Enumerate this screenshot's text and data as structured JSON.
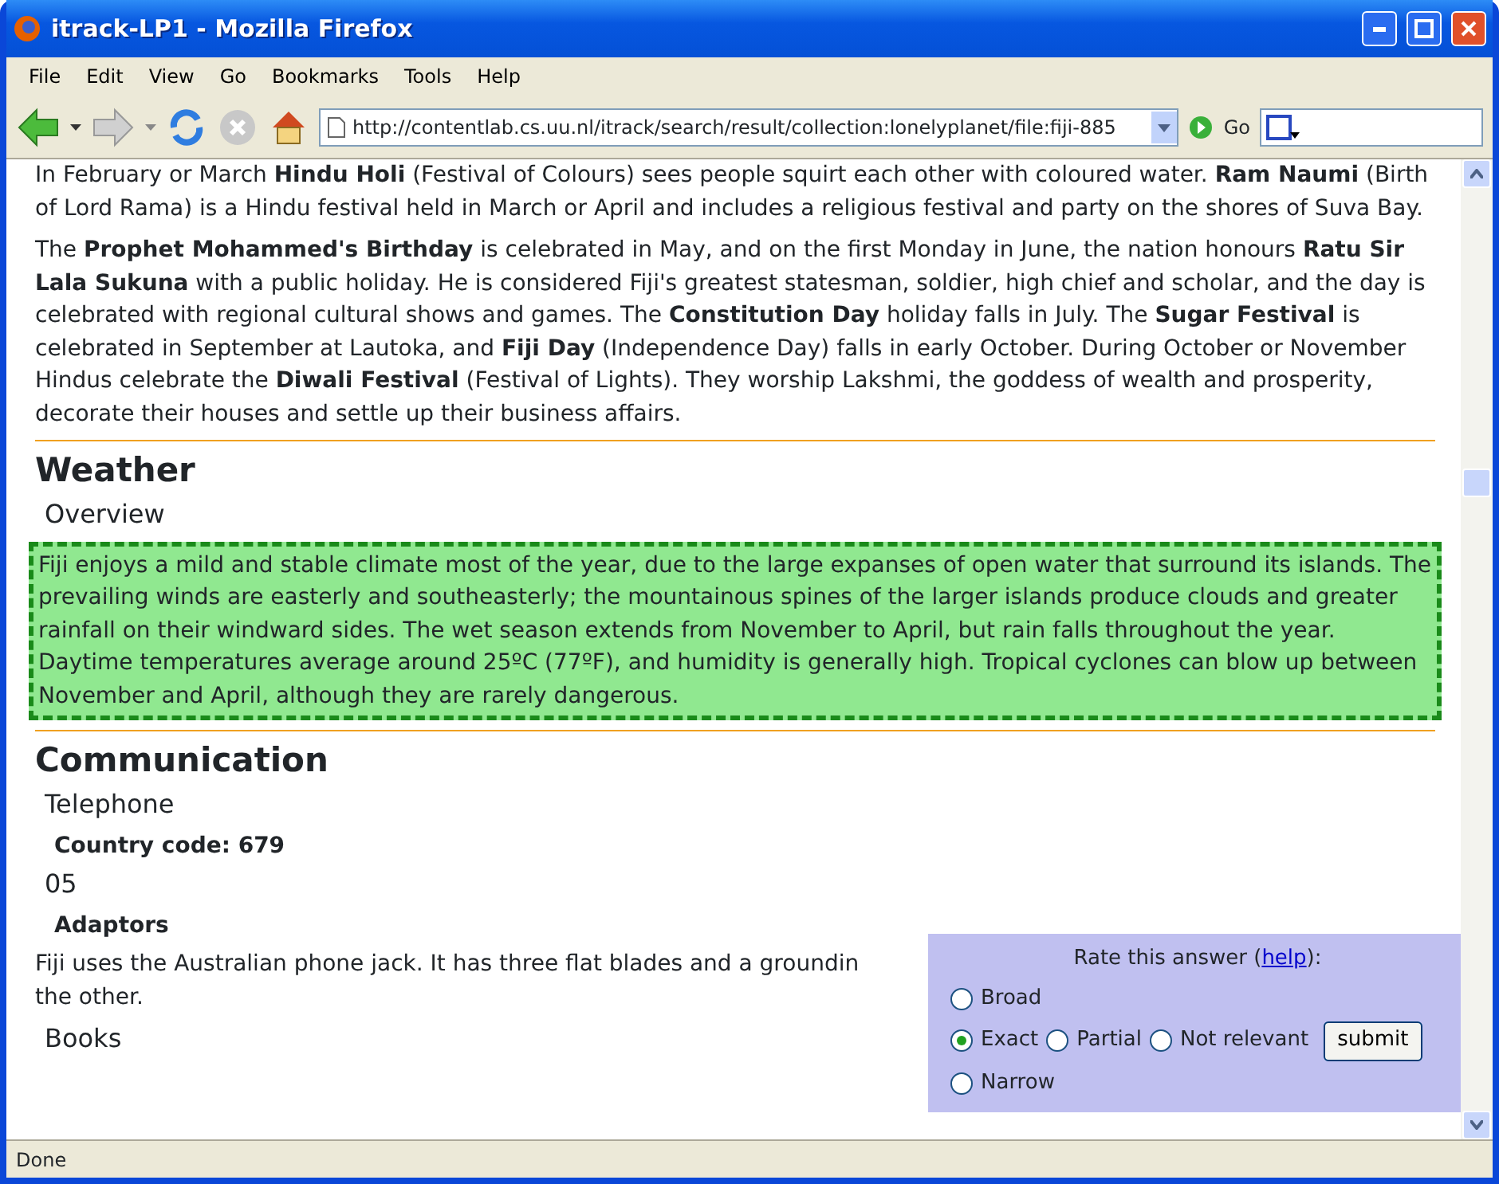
{
  "window": {
    "title": "itrack-LP1 - Mozilla Firefox"
  },
  "menu": [
    "File",
    "Edit",
    "View",
    "Go",
    "Bookmarks",
    "Tools",
    "Help"
  ],
  "toolbar": {
    "url": "http://contentlab.cs.uu.nl/itrack/search/result/collection:lonelyplanet/file:fiji-885",
    "go": "Go"
  },
  "content": [
    {
      "kind": "para",
      "text": "In February or March **Hindu Holi** (Festival of Colours) sees people squirt each other with coloured water. **Ram Naumi** (Birth of Lord Rama) is a Hindu festival held in March or April and includes a religious festival and party on the shores of Suva Bay."
    },
    {
      "kind": "para",
      "text": "The **Prophet Mohammed's Birthday** is celebrated in May, and on the first Monday in June, the nation honours **Ratu Sir Lala Sukuna** with a public holiday. He is considered Fiji's greatest statesman, soldier, high chief and scholar, and the day is celebrated with regional cultural shows and games. The **Constitution Day** holiday falls in July. The **Sugar Festival** is celebrated in September at Lautoka, and **Fiji Day** (Independence Day) falls in early October. During October or November Hindus celebrate the **Diwali Festival** (Festival of Lights). They worship Lakshmi, the goddess of wealth and prosperity, decorate their houses and settle up their business affairs."
    },
    {
      "kind": "rule"
    },
    {
      "kind": "h1",
      "text": "Weather"
    },
    {
      "kind": "h2",
      "text": "Overview"
    },
    {
      "kind": "answer",
      "text": "Fiji enjoys a mild and stable climate most of the year, due to the large expanses of open water that surround its islands. The prevailing winds are easterly and southeasterly; the mountainous spines of the larger islands produce clouds and greater rainfall on their windward sides. The wet season extends from November to April, but rain falls throughout the year. Daytime temperatures average around 25ºC (77ºF), and humidity is generally high. Tropical cyclones can blow up between November and April, although they are rarely dangerous."
    },
    {
      "kind": "rule"
    },
    {
      "kind": "h1",
      "text": "Communication"
    },
    {
      "kind": "h2",
      "text": "Telephone"
    },
    {
      "kind": "h3",
      "text": "Country code: 679"
    },
    {
      "kind": "h2",
      "text": "05"
    },
    {
      "kind": "h3",
      "text": "Adaptors"
    },
    {
      "kind": "lines",
      "lines": [
        "Fiji uses the Australian phone jack. It has three flat blades and a groundin",
        "the other."
      ]
    },
    {
      "kind": "h2",
      "text": "Books"
    }
  ],
  "rating": {
    "prompt": "Rate this answer (",
    "link": "help",
    "suffix": "):",
    "submit": "submit",
    "rows": [
      [
        {
          "label": "Broad",
          "selected": false
        }
      ],
      [
        {
          "label": "Exact",
          "selected": true
        },
        {
          "label": "Partial",
          "selected": false
        },
        {
          "label": "Not relevant",
          "selected": false
        }
      ],
      [
        {
          "label": "Narrow",
          "selected": false
        }
      ]
    ]
  },
  "status_bar": {
    "text": "Done"
  }
}
